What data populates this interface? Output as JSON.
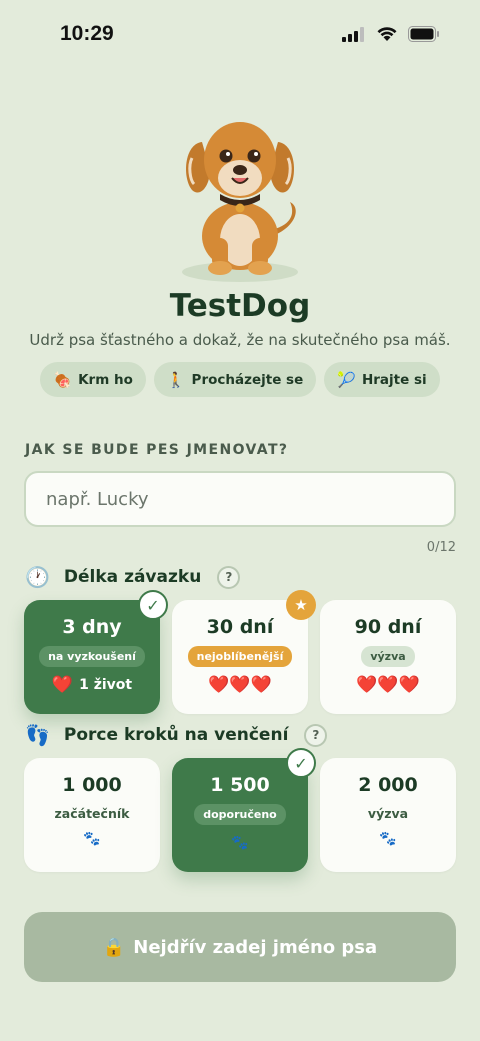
{
  "status": {
    "time": "10:29"
  },
  "header": {
    "title": "TestDog",
    "subtitle": "Udrž psa šťastného a dokaž, že na skutečného psa máš."
  },
  "chips": [
    {
      "icon": "🍖",
      "label": "Krm ho"
    },
    {
      "icon": "🚶",
      "label": "Procházejte se"
    },
    {
      "icon": "🎾",
      "label": "Hrajte si"
    }
  ],
  "name_section": {
    "label": "JAK SE BUDE PES JMENOVAT?",
    "placeholder": "např. Lucky",
    "value": "",
    "count": "0/12"
  },
  "commitment": {
    "icon": "🕐",
    "title": "Délka závazku",
    "help": "?",
    "options": [
      {
        "value": "3 dny",
        "badge": "na vyzkoušení",
        "hearts": "❤️",
        "lives": "1 život",
        "selected": true
      },
      {
        "value": "30 dní",
        "badge": "nejoblíbenější",
        "hearts": "❤️❤️❤️",
        "selected": false,
        "starred": true
      },
      {
        "value": "90 dní",
        "badge": "výzva",
        "hearts": "❤️❤️❤️",
        "selected": false
      }
    ]
  },
  "steps": {
    "icon": "👣",
    "title": "Porce kroků na venčení",
    "help": "?",
    "options": [
      {
        "value": "1 000",
        "label": "začátečník",
        "selected": false
      },
      {
        "value": "1 500",
        "label": "doporučeno",
        "selected": true
      },
      {
        "value": "2 000",
        "label": "výzva",
        "selected": false
      }
    ]
  },
  "cta": {
    "icon": "🔒",
    "label": "Nejdřív zadej jméno psa"
  },
  "colors": {
    "background": "#e3ebdb",
    "accent": "#3f7a4a",
    "orange": "#e4a43b",
    "cta_disabled": "#a8b9a1"
  }
}
